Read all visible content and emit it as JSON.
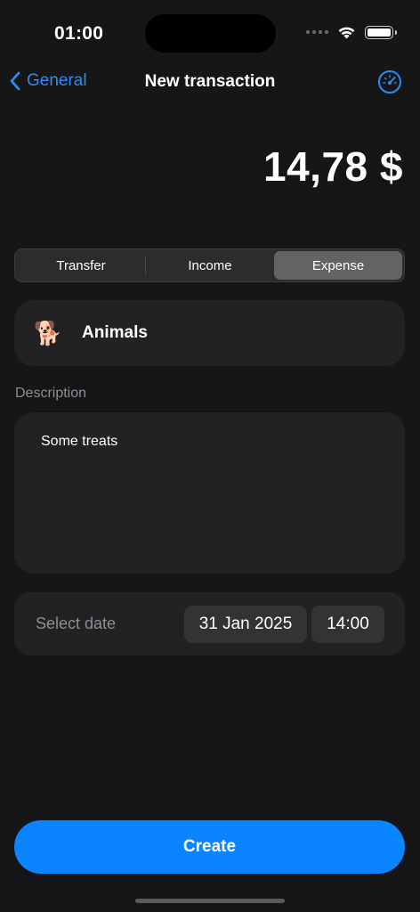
{
  "status_bar": {
    "time": "01:00"
  },
  "nav": {
    "back_label": "General",
    "title": "New transaction"
  },
  "amount": "14,78 $",
  "type_selector": {
    "options": [
      "Transfer",
      "Income",
      "Expense"
    ],
    "selected": "Expense"
  },
  "category": {
    "emoji": "🐕",
    "label": "Animals"
  },
  "description": {
    "label": "Description",
    "value": "Some treats"
  },
  "date": {
    "label": "Select date",
    "day": "31 Jan 2025",
    "time": "14:00"
  },
  "create_label": "Create",
  "colors": {
    "accent": "#0a84ff",
    "background": "#161618",
    "card": "#222224"
  }
}
